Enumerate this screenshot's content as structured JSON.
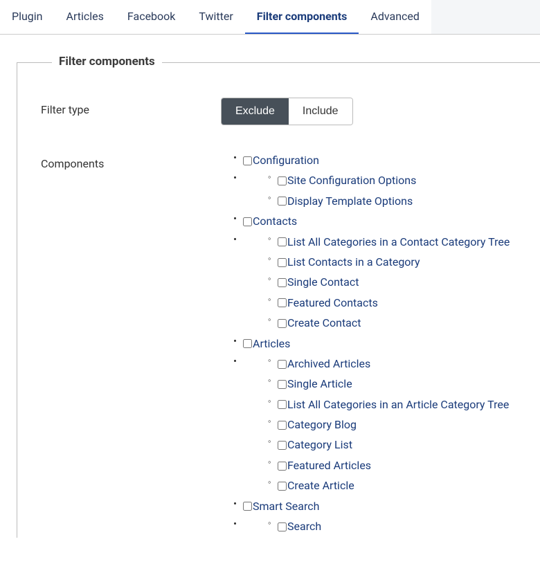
{
  "tabs": {
    "plugin": "Plugin",
    "articles": "Articles",
    "facebook": "Facebook",
    "twitter": "Twitter",
    "filter_components": "Filter components",
    "advanced": "Advanced"
  },
  "fieldset": {
    "legend": "Filter components",
    "filter_type": {
      "label": "Filter type",
      "exclude": "Exclude",
      "include": "Include"
    },
    "components": {
      "label": "Components",
      "tree": {
        "configuration": {
          "label": "Configuration",
          "site_config": "Site Configuration Options",
          "display_template": "Display Template Options"
        },
        "contacts": {
          "label": "Contacts",
          "list_all_cat": "List All Categories in a Contact Category Tree",
          "list_in_cat": "List Contacts in a Category",
          "single": "Single Contact",
          "featured": "Featured Contacts",
          "create": "Create Contact"
        },
        "articles": {
          "label": "Articles",
          "archived": "Archived Articles",
          "single": "Single Article",
          "list_all_cat": "List All Categories in an Article Category Tree",
          "cat_blog": "Category Blog",
          "cat_list": "Category List",
          "featured": "Featured Articles",
          "create": "Create Article"
        },
        "smart_search": {
          "label": "Smart Search",
          "search": "Search"
        }
      }
    }
  }
}
